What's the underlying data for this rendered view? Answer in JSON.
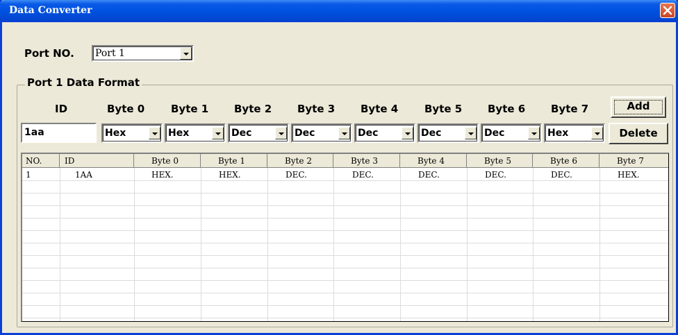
{
  "window": {
    "title": "Data Converter"
  },
  "port": {
    "label": "Port NO.",
    "selected": "Port 1"
  },
  "group": {
    "title": "Port 1 Data Format"
  },
  "format": {
    "id_header": "ID",
    "id_value": "1aa",
    "byte_headers": [
      "Byte 0",
      "Byte 1",
      "Byte 2",
      "Byte 3",
      "Byte 4",
      "Byte 5",
      "Byte 6",
      "Byte 7"
    ],
    "byte_values": [
      "Hex",
      "Hex",
      "Dec",
      "Dec",
      "Dec",
      "Dec",
      "Dec",
      "Hex"
    ]
  },
  "buttons": {
    "add": "Add",
    "delete": "Delete"
  },
  "table": {
    "columns": [
      "NO.",
      "ID",
      "Byte 0",
      "Byte 1",
      "Byte 2",
      "Byte 3",
      "Byte 4",
      "Byte 5",
      "Byte 6",
      "Byte 7"
    ],
    "rows": [
      [
        "1",
        "1AA",
        "HEX.",
        "HEX.",
        "DEC.",
        "DEC.",
        "DEC.",
        "DEC.",
        "DEC.",
        "HEX."
      ]
    ]
  }
}
